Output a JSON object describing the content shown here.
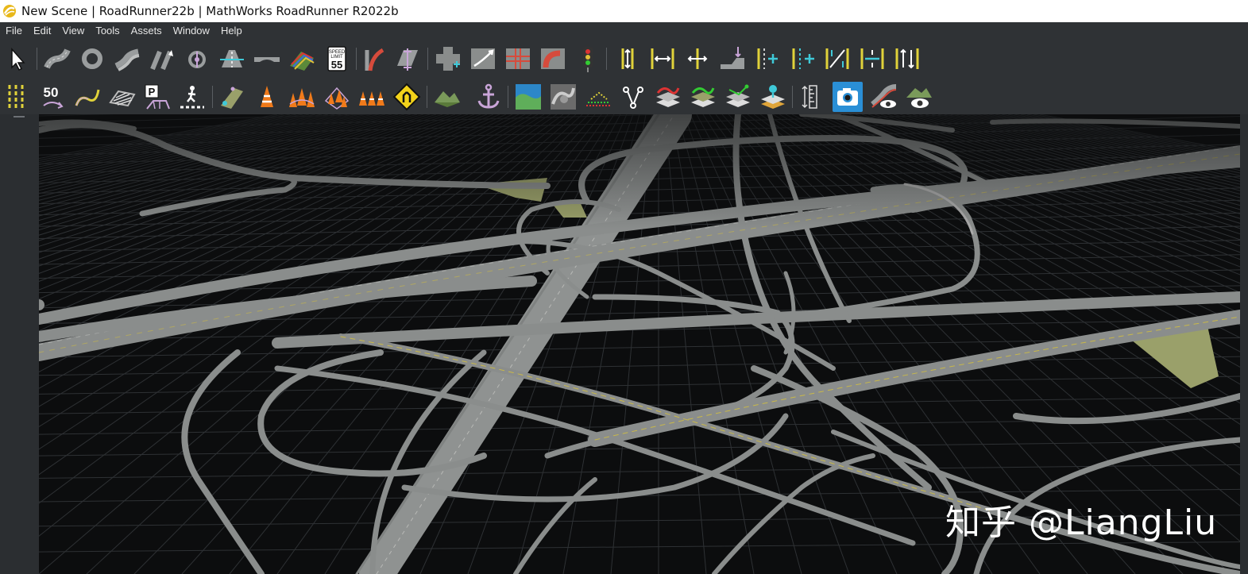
{
  "window": {
    "title": "New Scene | RoadRunner22b | MathWorks RoadRunner R2022b",
    "icon": "roadrunner-logo-icon"
  },
  "menu": {
    "items": [
      "File",
      "Edit",
      "View",
      "Tools",
      "Assets",
      "Window",
      "Help"
    ]
  },
  "toolbar_1": {
    "tools": [
      "select-tool-icon",
      "road-plan-tool-icon",
      "roundabout-tool-icon",
      "lane-carving-tool-icon",
      "road-construction-tool-icon",
      "spin-tool-icon",
      "lane-tool-icon",
      "bridge-span-tool-icon",
      "marking-curve-tool-icon",
      "sign-tool-icon",
      "prop-curve-tool-icon",
      "lane-width-tool-icon",
      "junction-tool-icon",
      "maneuver-tool-icon",
      "corner-tool-icon",
      "crosswalk-tool-icon",
      "signal-tool-icon",
      "lane-add-tool-icon",
      "lane-width-adjust-icon",
      "lane-form-icon",
      "lane-shift-icon",
      "lane-split-icon",
      "lane-insert-icon",
      "lane-marking-icon",
      "lane-carve-icon",
      "lane-offset-icon",
      "lane-direction-icon"
    ],
    "speed_sign_line1": "SPEED",
    "speed_sign_line2": "LIMIT",
    "speed_sign_value": "55"
  },
  "toolbar_2": {
    "tools": [
      "marking-point-tool-icon",
      "speed-marking-tool-icon",
      "curve-marking-tool-icon",
      "area-marking-tool-icon",
      "parking-tool-icon",
      "crosswalk-marking-icon",
      "surface-tool-icon",
      "prop-point-tool-icon",
      "prop-curve-cones-icon",
      "prop-polygon-icon",
      "prop-set-icon",
      "prop-sign-icon",
      "elevation-map-icon",
      "anchor-tool-icon",
      "terrain-tool-icon",
      "texture-tool-icon",
      "point-cloud-tool-icon",
      "scenario-tool-icon",
      "layer-tool-icon",
      "layer-edit-icon",
      "layer-add-icon",
      "layer-stack-icon",
      "measure-tool-icon",
      "camera-tool-icon",
      "visibility-tool-icon",
      "world-settings-icon"
    ],
    "speed_marking_value": "50",
    "active_tool": "camera-tool-icon"
  },
  "colors": {
    "chrome": "#2f3235",
    "viewport_bg": "#0c0d0e",
    "grid": "#2e3134",
    "road": "#8a8d8c",
    "terrain": "#9aa06a",
    "active_button": "#2a8fd6",
    "lane_marking": "#c8b84a"
  },
  "watermark": {
    "text": "知乎 @LiangLiu"
  }
}
